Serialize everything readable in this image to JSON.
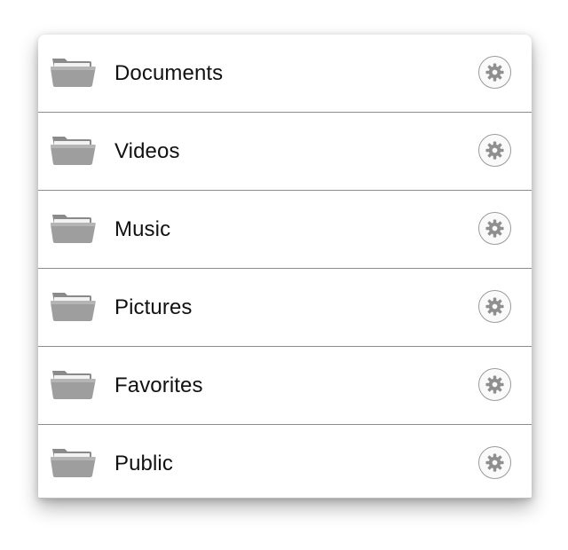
{
  "folders": [
    {
      "label": "Documents",
      "icon": "folder-icon",
      "action_icon": "gear-icon"
    },
    {
      "label": "Videos",
      "icon": "folder-icon",
      "action_icon": "gear-icon"
    },
    {
      "label": "Music",
      "icon": "folder-icon",
      "action_icon": "gear-icon"
    },
    {
      "label": "Pictures",
      "icon": "folder-icon",
      "action_icon": "gear-icon"
    },
    {
      "label": "Favorites",
      "icon": "folder-icon",
      "action_icon": "gear-icon"
    },
    {
      "label": "Public",
      "icon": "folder-icon",
      "action_icon": "gear-icon"
    }
  ],
  "colors": {
    "folder_back": "#8a8a8a",
    "folder_front": "#9e9e9e",
    "gear": "#8f8f8f",
    "separator": "#8c8c8c",
    "text": "#111111"
  }
}
